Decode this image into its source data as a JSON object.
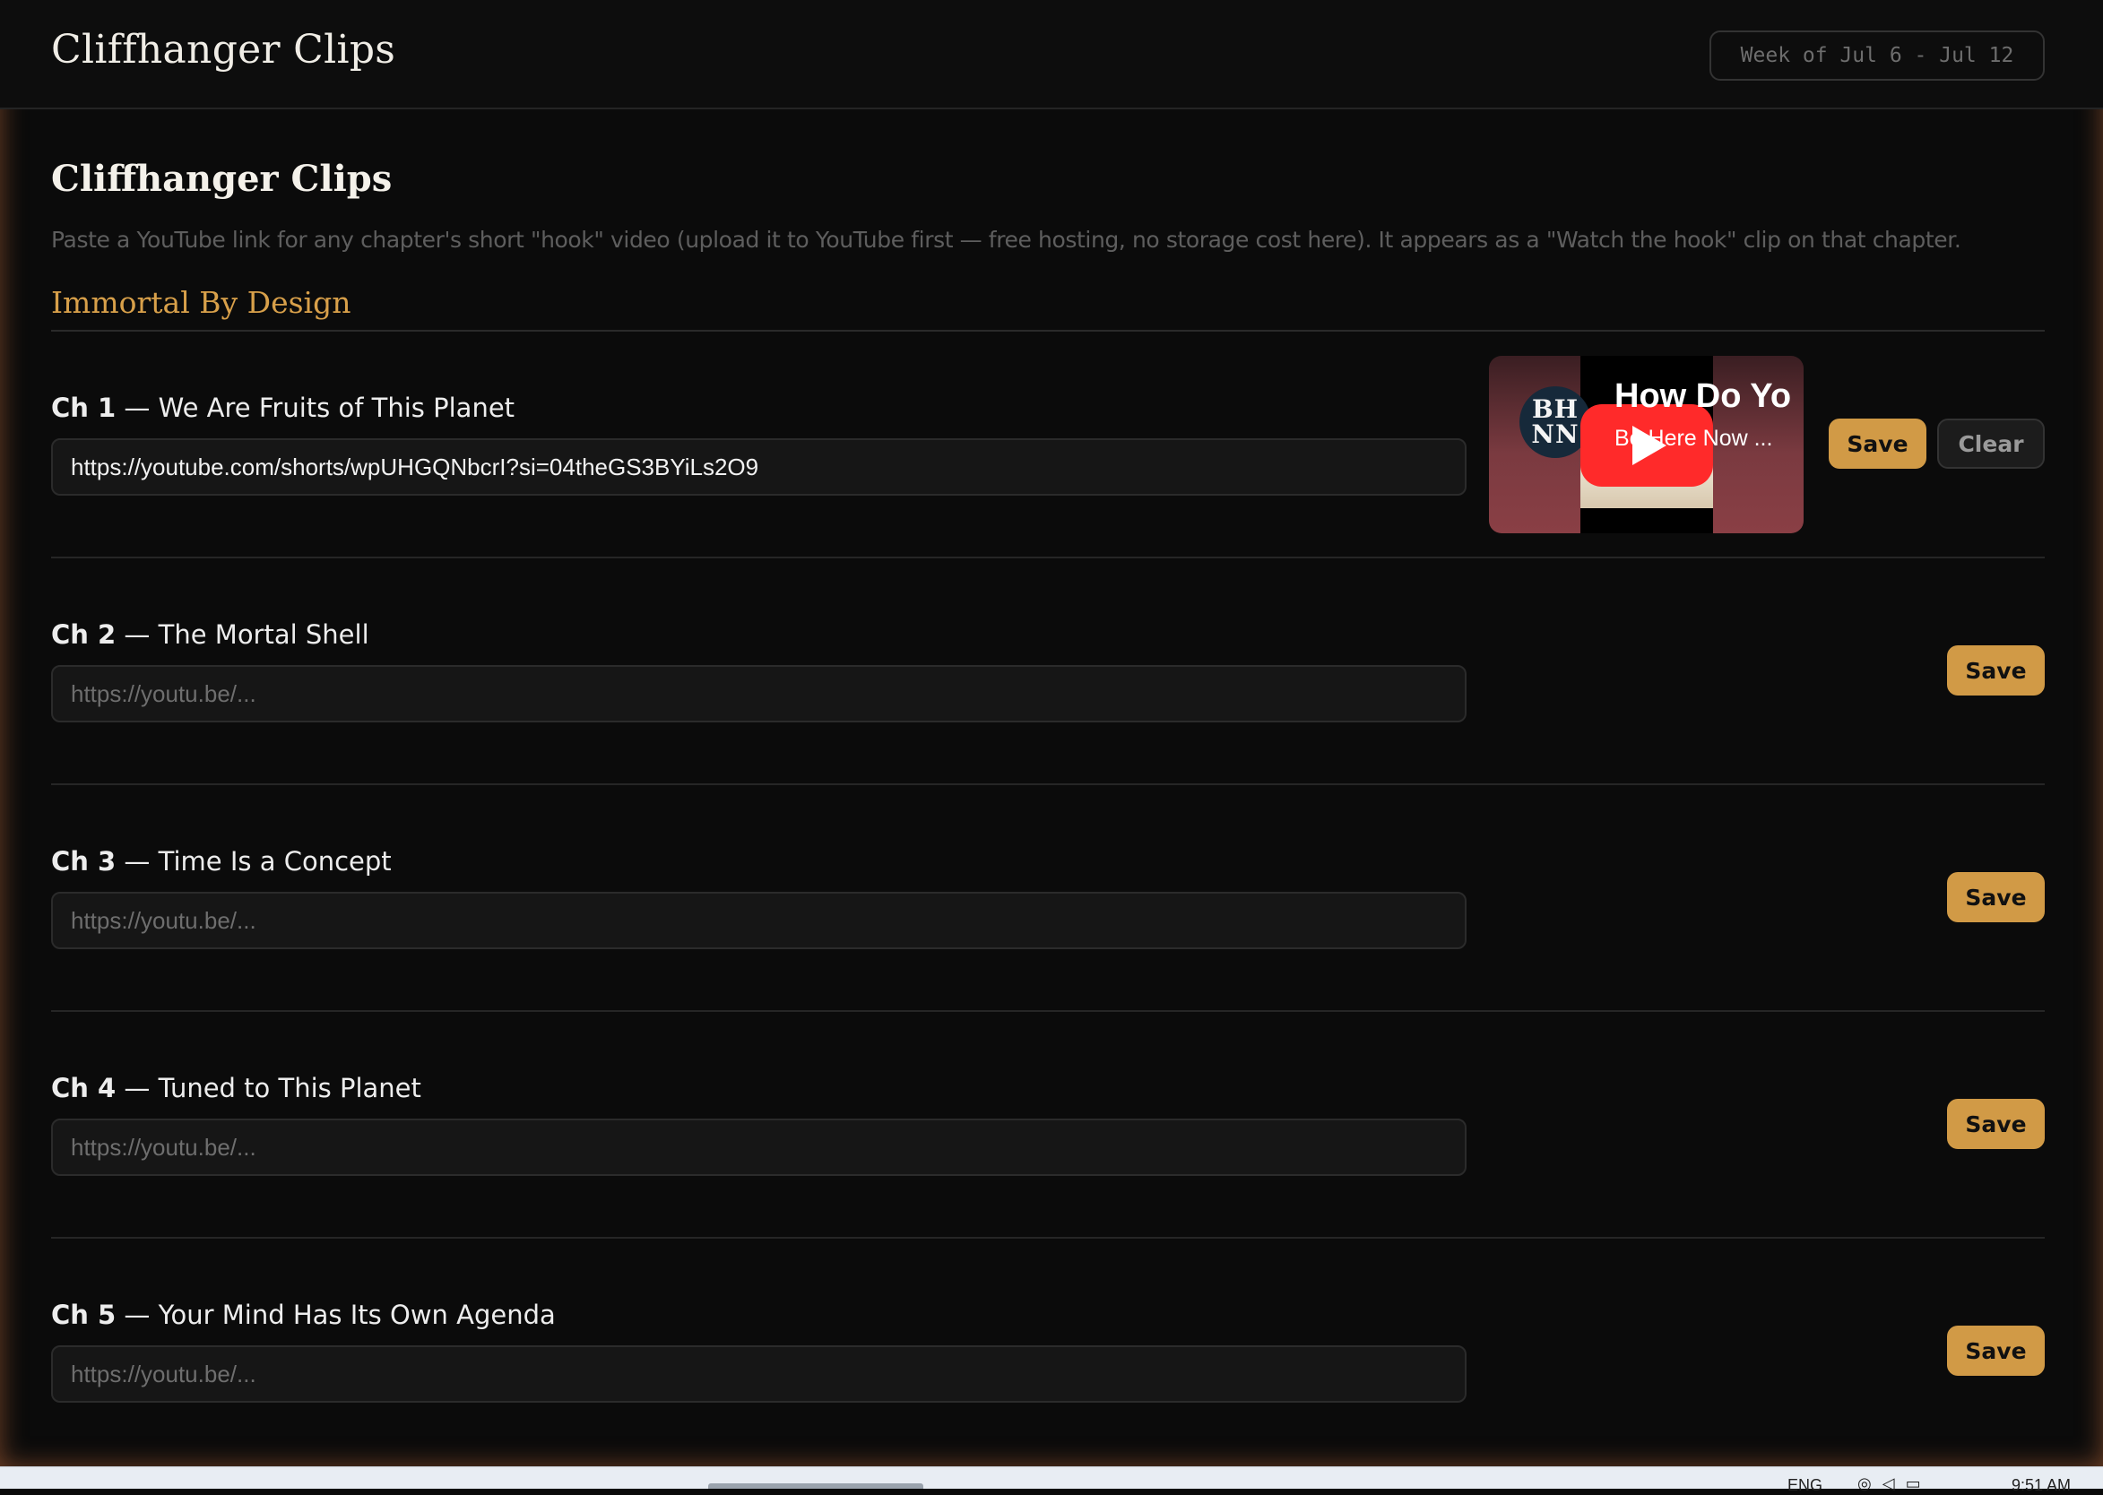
{
  "header": {
    "brand": "Cliffhanger Clips",
    "week": "Week of Jul 6 - Jul 12"
  },
  "page": {
    "title": "Cliffhanger Clips",
    "description": "Paste a YouTube link for any chapter's short \"hook\" video (upload it to YouTube first — free hosting, no storage cost here). It appears as a \"Watch the hook\" clip on that chapter.",
    "book_title": "Immortal By Design"
  },
  "chapters": [
    {
      "num": "Ch 1",
      "title": " — We Are Fruits of This Planet",
      "value": "https://youtube.com/shorts/wpUHGQNbcrI?si=04theGS3BYiLs2O9",
      "placeholder": "https://youtu.be/...",
      "save_label": "Save",
      "clear_label": "Clear"
    },
    {
      "num": "Ch 2",
      "title": " — The Mortal Shell",
      "value": "",
      "placeholder": "https://youtu.be/...",
      "save_label": "Save"
    },
    {
      "num": "Ch 3",
      "title": " — Time Is a Concept",
      "value": "",
      "placeholder": "https://youtu.be/...",
      "save_label": "Save"
    },
    {
      "num": "Ch 4",
      "title": " — Tuned to This Planet",
      "value": "",
      "placeholder": "https://youtu.be/...",
      "save_label": "Save"
    },
    {
      "num": "Ch 5",
      "title": " — Your Mind Has Its Own Agenda",
      "value": "",
      "placeholder": "https://youtu.be/...",
      "save_label": "Save"
    }
  ],
  "preview": {
    "channel_line1": "BH",
    "channel_line2": "NN",
    "title": "How Do Yo",
    "subtitle": "Be Here Now ...",
    "icon": "play-icon"
  },
  "taskbar": {
    "lang": "ENG",
    "time": "9:51 AM"
  },
  "colors": {
    "accent": "#d19a46",
    "book_title": "#d8a04a",
    "background": "#0b0b0b",
    "youtube_red": "#ff0000"
  }
}
